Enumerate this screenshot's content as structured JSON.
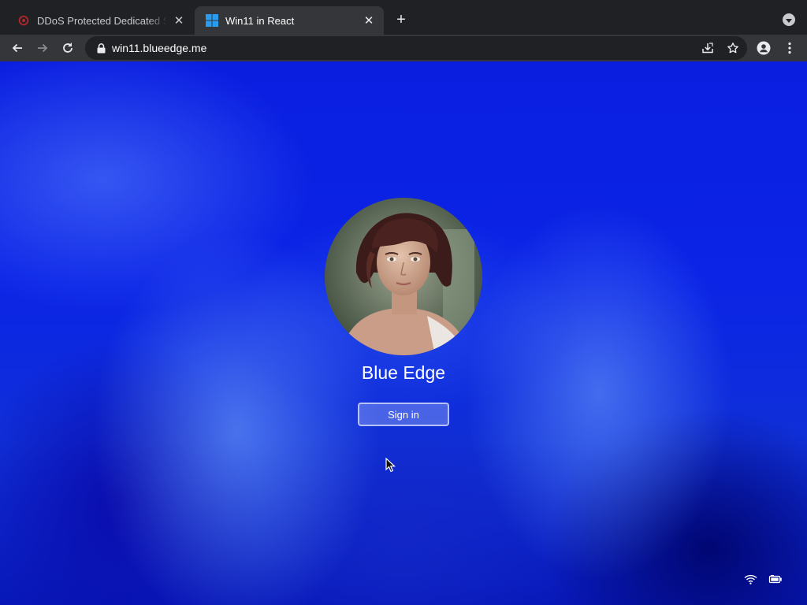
{
  "browser": {
    "tabs": [
      {
        "title": "DDoS Protected Dedicated Ser",
        "favicon": "shield-logo-icon",
        "active": false
      },
      {
        "title": "Win11 in React",
        "favicon": "windows-logo-icon",
        "active": true
      }
    ],
    "new_tab_label": "+",
    "address": {
      "url": "win11.blueedge.me",
      "secure": true
    }
  },
  "lockscreen": {
    "username": "Blue Edge",
    "signin_label": "Sign in",
    "avatar": "user-portrait",
    "tray_icons": [
      "wifi-icon",
      "battery-icon"
    ]
  },
  "colors": {
    "tab_strip": "#202124",
    "toolbar": "#35363a",
    "accent_blue": "#0b24e6"
  }
}
